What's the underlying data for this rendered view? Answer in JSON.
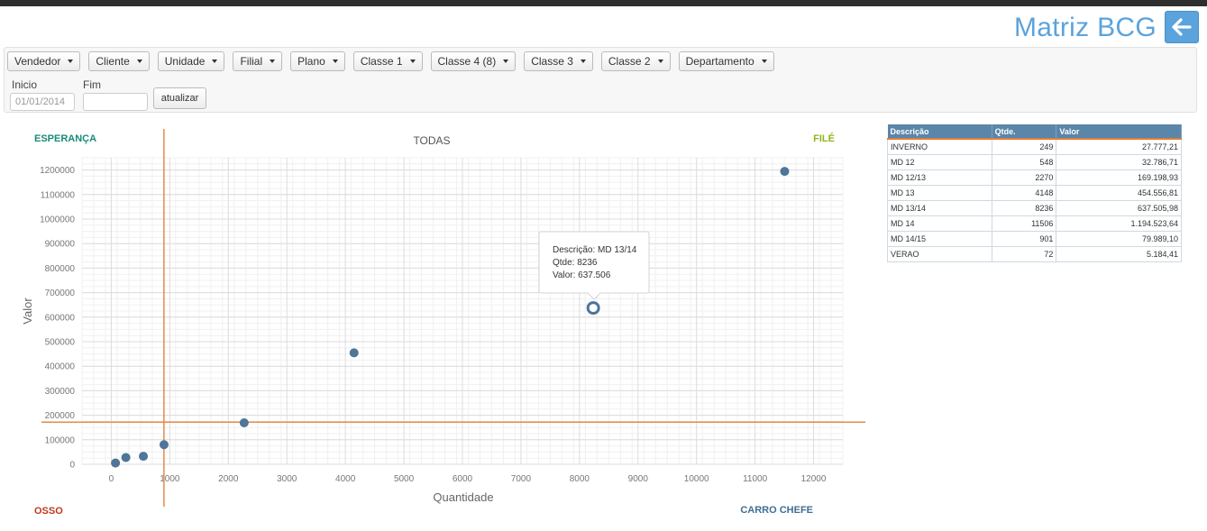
{
  "header": {
    "title": "Matriz BCG",
    "back_icon": "arrow-left-icon",
    "accent": "#5ba3dc"
  },
  "filters": {
    "dropdowns": [
      "Vendedor",
      "Cliente",
      "Unidade",
      "Filial",
      "Plano",
      "Classe 1",
      "Classe 4 (8)",
      "Classe 3",
      "Classe 2",
      "Departamento"
    ],
    "inicio_label": "Inicio",
    "inicio_value": "01/01/2014",
    "fim_label": "Fim",
    "fim_value": "",
    "update_label": "atualizar"
  },
  "quadrants": {
    "top_left": "ESPERANÇA",
    "top_right": "FILÉ",
    "bottom_left": "OSSO",
    "bottom_right": "CARRO CHEFE",
    "colors": {
      "top_left": "#1a8a7a",
      "top_right": "#8fb51c",
      "bottom_left": "#c0391b",
      "bottom_right": "#3f6e93"
    }
  },
  "tooltip": {
    "line1": "Descrição: MD 13/14",
    "line2": "Qtde: 8236",
    "line3": "Valor: 637.506"
  },
  "chart_data": {
    "type": "scatter",
    "title": "TODAS",
    "xlabel": "Quantidade",
    "ylabel": "Valor",
    "xlim": [
      -500,
      12500
    ],
    "ylim": [
      0,
      1250000
    ],
    "xticks": [
      0,
      1000,
      2000,
      3000,
      4000,
      5000,
      6000,
      7000,
      8000,
      9000,
      10000,
      11000,
      12000
    ],
    "yticks": [
      0,
      100000,
      200000,
      300000,
      400000,
      500000,
      600000,
      700000,
      800000,
      900000,
      1000000,
      1100000,
      1200000
    ],
    "grid": true,
    "reference_lines": {
      "x": 900,
      "y": 172000,
      "color": "#e8894a"
    },
    "point_color": "#4f7599",
    "highlight_index": 4,
    "points": [
      {
        "label": "INVERNO",
        "x": 249,
        "y": 27777.21
      },
      {
        "label": "MD 12",
        "x": 548,
        "y": 32786.71
      },
      {
        "label": "MD 12/13",
        "x": 2270,
        "y": 169198.93
      },
      {
        "label": "MD 13",
        "x": 4148,
        "y": 454556.81
      },
      {
        "label": "MD 13/14",
        "x": 8236,
        "y": 637505.98
      },
      {
        "label": "MD 14",
        "x": 11506,
        "y": 1194523.64
      },
      {
        "label": "MD 14/15",
        "x": 901,
        "y": 79989.1
      },
      {
        "label": "VERAO",
        "x": 72,
        "y": 5184.41
      }
    ]
  },
  "table": {
    "headers": [
      "Descrição",
      "Qtde.",
      "Valor"
    ],
    "rows": [
      [
        "INVERNO",
        "249",
        "27.777,21"
      ],
      [
        "MD 12",
        "548",
        "32.786,71"
      ],
      [
        "MD 12/13",
        "2270",
        "169.198,93"
      ],
      [
        "MD 13",
        "4148",
        "454.556,81"
      ],
      [
        "MD 13/14",
        "8236",
        "637.505,98"
      ],
      [
        "MD 14",
        "11506",
        "1.194.523,64"
      ],
      [
        "MD 14/15",
        "901",
        "79.989,10"
      ],
      [
        "VERAO",
        "72",
        "5.184,41"
      ]
    ]
  }
}
